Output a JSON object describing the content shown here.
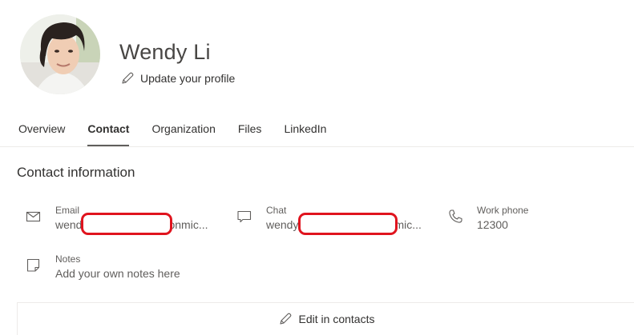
{
  "profile": {
    "name": "Wendy Li",
    "update_link": "Update your profile"
  },
  "tabs": [
    {
      "label": "Overview",
      "active": false
    },
    {
      "label": "Contact",
      "active": true
    },
    {
      "label": "Organization",
      "active": false
    },
    {
      "label": "Files",
      "active": false
    },
    {
      "label": "LinkedIn",
      "active": false
    }
  ],
  "contact": {
    "section_title": "Contact information",
    "email": {
      "label": "Email",
      "value_start": "wend",
      "value_end": "onmic..."
    },
    "chat": {
      "label": "Chat",
      "value_start": "wendy",
      "value_end": "mic..."
    },
    "work_phone": {
      "label": "Work phone",
      "value": "12300"
    },
    "notes": {
      "label": "Notes",
      "placeholder": "Add your own notes here"
    }
  },
  "edit_button": "Edit in contacts",
  "colors": {
    "redaction": "#e0141e",
    "text": "#323130",
    "muted": "#605e5c"
  },
  "icons": [
    "pencil-icon",
    "mail-icon",
    "chat-icon",
    "phone-icon",
    "note-icon"
  ]
}
